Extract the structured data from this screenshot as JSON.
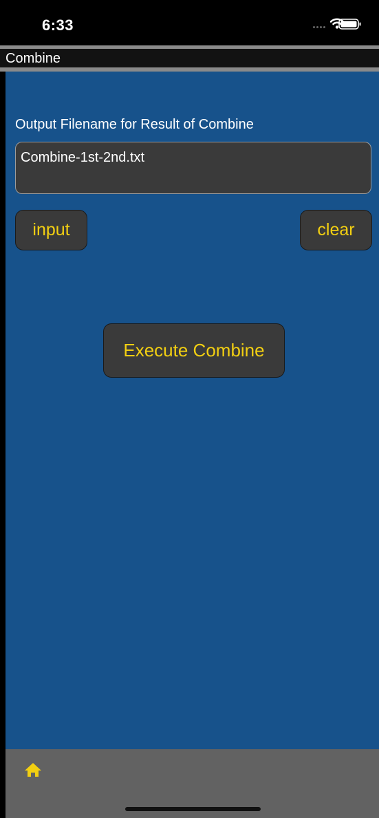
{
  "status_bar": {
    "time": "6:33"
  },
  "title_bar": {
    "title": "Combine"
  },
  "form": {
    "output_label": "Output Filename for Result of Combine",
    "filename_value": "Combine-1st-2nd.txt"
  },
  "buttons": {
    "input_label": "input",
    "clear_label": "clear",
    "execute_label": "Execute Combine"
  },
  "tab_bar": {
    "home_icon": "home-icon"
  },
  "colors": {
    "background": "#17528b",
    "button_text": "#f2cf12",
    "button_bg": "#3a3a3a",
    "tab_bar": "#626262"
  }
}
